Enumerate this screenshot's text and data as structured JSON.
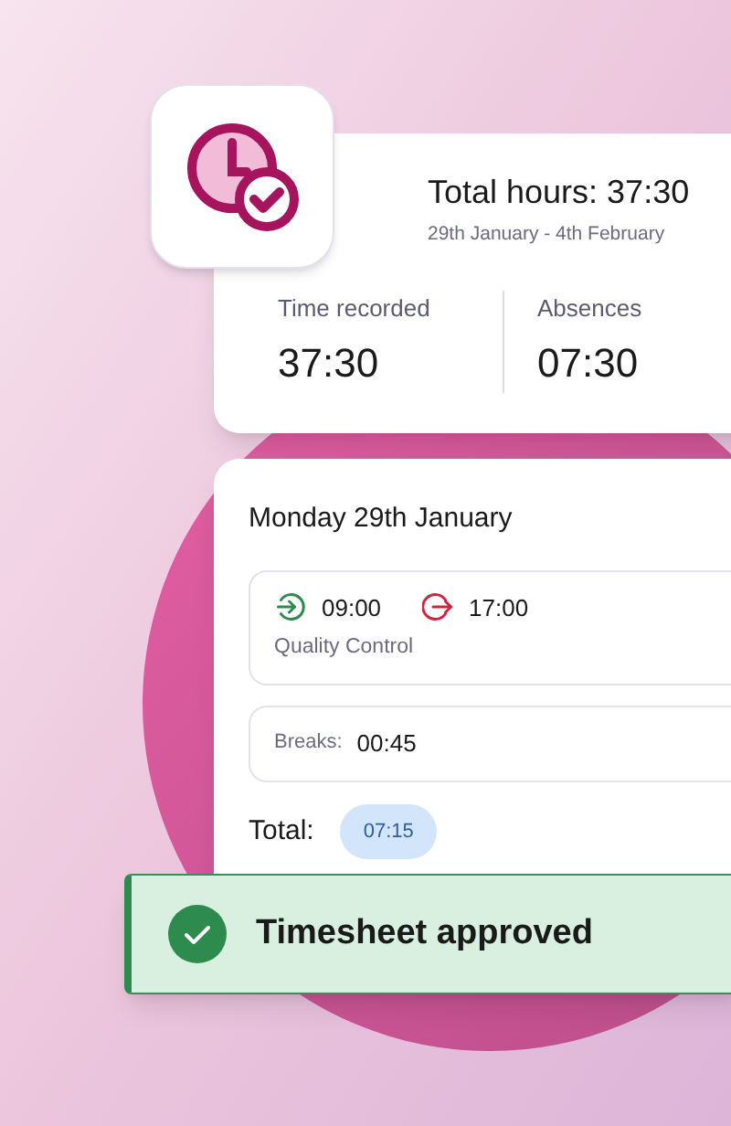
{
  "summary": {
    "title": "Total hours: 37:30",
    "date_range": "29th January - 4th February",
    "stats": [
      {
        "label": "Time recorded",
        "value": "37:30"
      },
      {
        "label": "Absences",
        "value": "07:30"
      }
    ]
  },
  "day": {
    "title": "Monday 29th January",
    "shift": {
      "clock_in": "09:00",
      "clock_out": "17:00",
      "department": "Quality Control"
    },
    "breaks": {
      "label": "Breaks:",
      "value": "00:45"
    },
    "total": {
      "label": "Total:",
      "value": "07:15"
    }
  },
  "toast": {
    "message": "Timesheet approved"
  }
}
